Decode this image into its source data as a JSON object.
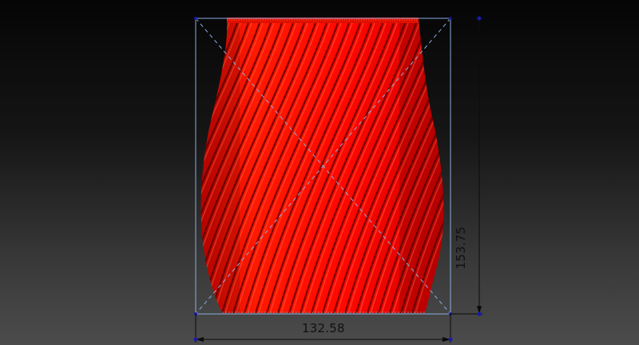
{
  "model": {
    "name": "",
    "color": "#ff0a00"
  },
  "dimensions": {
    "width_label": "132.58",
    "height_label": "153.75",
    "line_color": "#0b0b0b",
    "handle_color": "#1a1aa8",
    "bbox_color": "#8aaee0"
  }
}
